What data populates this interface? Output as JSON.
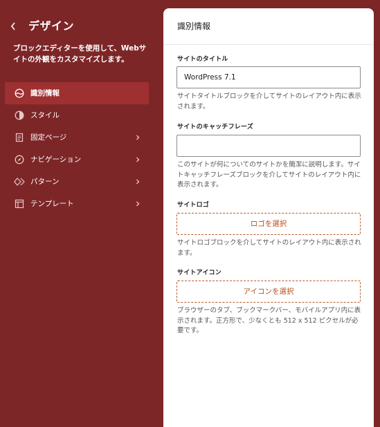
{
  "sidebar": {
    "title": "デザイン",
    "description": "ブロックエディターを使用して、Webサイトの外観をカスタマイズします。",
    "items": [
      {
        "label": "識別情報",
        "icon": "identity-icon",
        "active": true
      },
      {
        "label": "スタイル",
        "icon": "half-circle-icon"
      },
      {
        "label": "固定ページ",
        "icon": "page-icon"
      },
      {
        "label": "ナビゲーション",
        "icon": "compass-icon"
      },
      {
        "label": "パターン",
        "icon": "diamond-icon"
      },
      {
        "label": "テンプレート",
        "icon": "layout-icon"
      }
    ]
  },
  "panel": {
    "title": "識別情報",
    "site_title": {
      "label": "サイトのタイトル",
      "value": "WordPress 7.1",
      "help": "サイトタイトルブロックを介してサイトのレイアウト内に表示されます。"
    },
    "tagline": {
      "label": "サイトのキャッチフレーズ",
      "value": "",
      "help": "このサイトが何についてのサイトかを簡潔に説明します。サイトキャッチフレーズブロックを介してサイトのレイアウト内に表示されます。"
    },
    "logo": {
      "label": "サイトロゴ",
      "button": "ロゴを選択",
      "help": "サイトロゴブロックを介してサイトのレイアウト内に表示されます。"
    },
    "icon": {
      "label": "サイトアイコン",
      "button": "アイコンを選択",
      "help": "ブラウザーのタブ、ブックマークバー、モバイルアプリ内に表示されます。正方形で、少なくとも 512 x 512 ピクセルが必要です。"
    }
  },
  "colors": {
    "sidebar_bg": "#7d2628",
    "active_item_bg": "#9e3032",
    "accent": "#b4501c"
  }
}
